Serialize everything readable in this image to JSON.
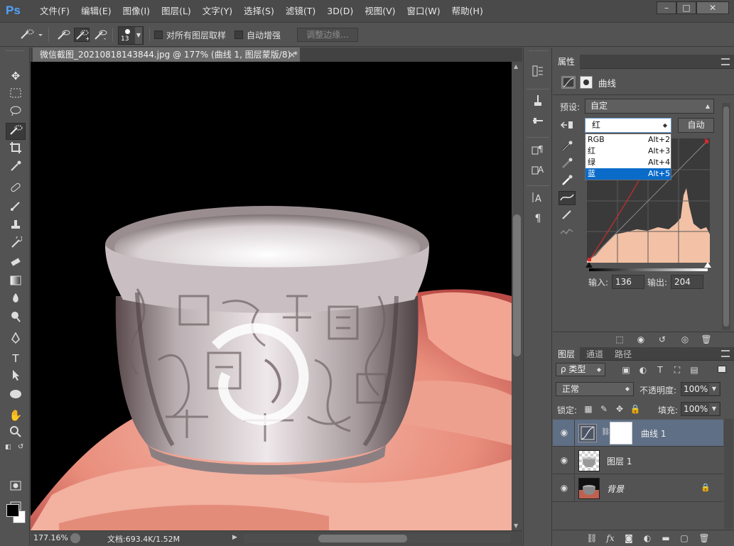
{
  "app": {
    "logo": "Ps",
    "window_controls": [
      "–",
      "□",
      "✕"
    ]
  },
  "menu": [
    "文件(F)",
    "编辑(E)",
    "图像(I)",
    "图层(L)",
    "文字(Y)",
    "选择(S)",
    "滤镜(T)",
    "3D(D)",
    "视图(V)",
    "窗口(W)",
    "帮助(H)"
  ],
  "options_bar": {
    "brush_size": "13",
    "sample_all_layers_label": "对所有图层取样",
    "sample_all_layers_checked": false,
    "auto_enhance_label": "自动增强",
    "auto_enhance_checked": false,
    "refine_edge_label": "调整边缘..."
  },
  "toolbar": {
    "active_tool": "quick-selection-tool",
    "foreground_color": "#000000",
    "background_color": "#ffffff"
  },
  "document": {
    "tab_title": "微信截图_20210818143844.jpg @ 177% (曲线 1, 图层蒙版/8) *",
    "tab_close": "×",
    "zoom": "177.16%",
    "doc_info": "文档:693.4K/1.52M"
  },
  "properties": {
    "tab_label": "属性",
    "title": "曲线",
    "preset_label": "预设:",
    "preset_value": "自定",
    "channel_value": "红",
    "auto_button": "自动",
    "input_label": "输入:",
    "input_value": "136",
    "output_label": "输出:",
    "output_value": "204",
    "curve_point": {
      "input": 136,
      "output": 204
    },
    "channel_options": [
      {
        "label": "RGB",
        "shortcut": "Alt+2"
      },
      {
        "label": "红",
        "shortcut": "Alt+3"
      },
      {
        "label": "绿",
        "shortcut": "Alt+4"
      },
      {
        "label": "蓝",
        "shortcut": "Alt+5"
      }
    ],
    "highlighted_option": "蓝"
  },
  "layers": {
    "tabs": [
      "图层",
      "通道",
      "路径"
    ],
    "kind_filter": "ρ 类型",
    "blend_mode": "正常",
    "opacity_label": "不透明度:",
    "opacity_value": "100%",
    "lock_label": "锁定:",
    "fill_label": "填充:",
    "fill_value": "100%",
    "items": [
      {
        "name": "曲线 1",
        "selected": true
      },
      {
        "name": "图层 1",
        "selected": false
      },
      {
        "name": "背景",
        "selected": false
      }
    ]
  },
  "colors": {
    "accent_blue": "#0a6bc9",
    "selected_layer": "#5f6f85",
    "histogram_fill": "#f3c1a6",
    "curve_red": "#d42c2c"
  }
}
